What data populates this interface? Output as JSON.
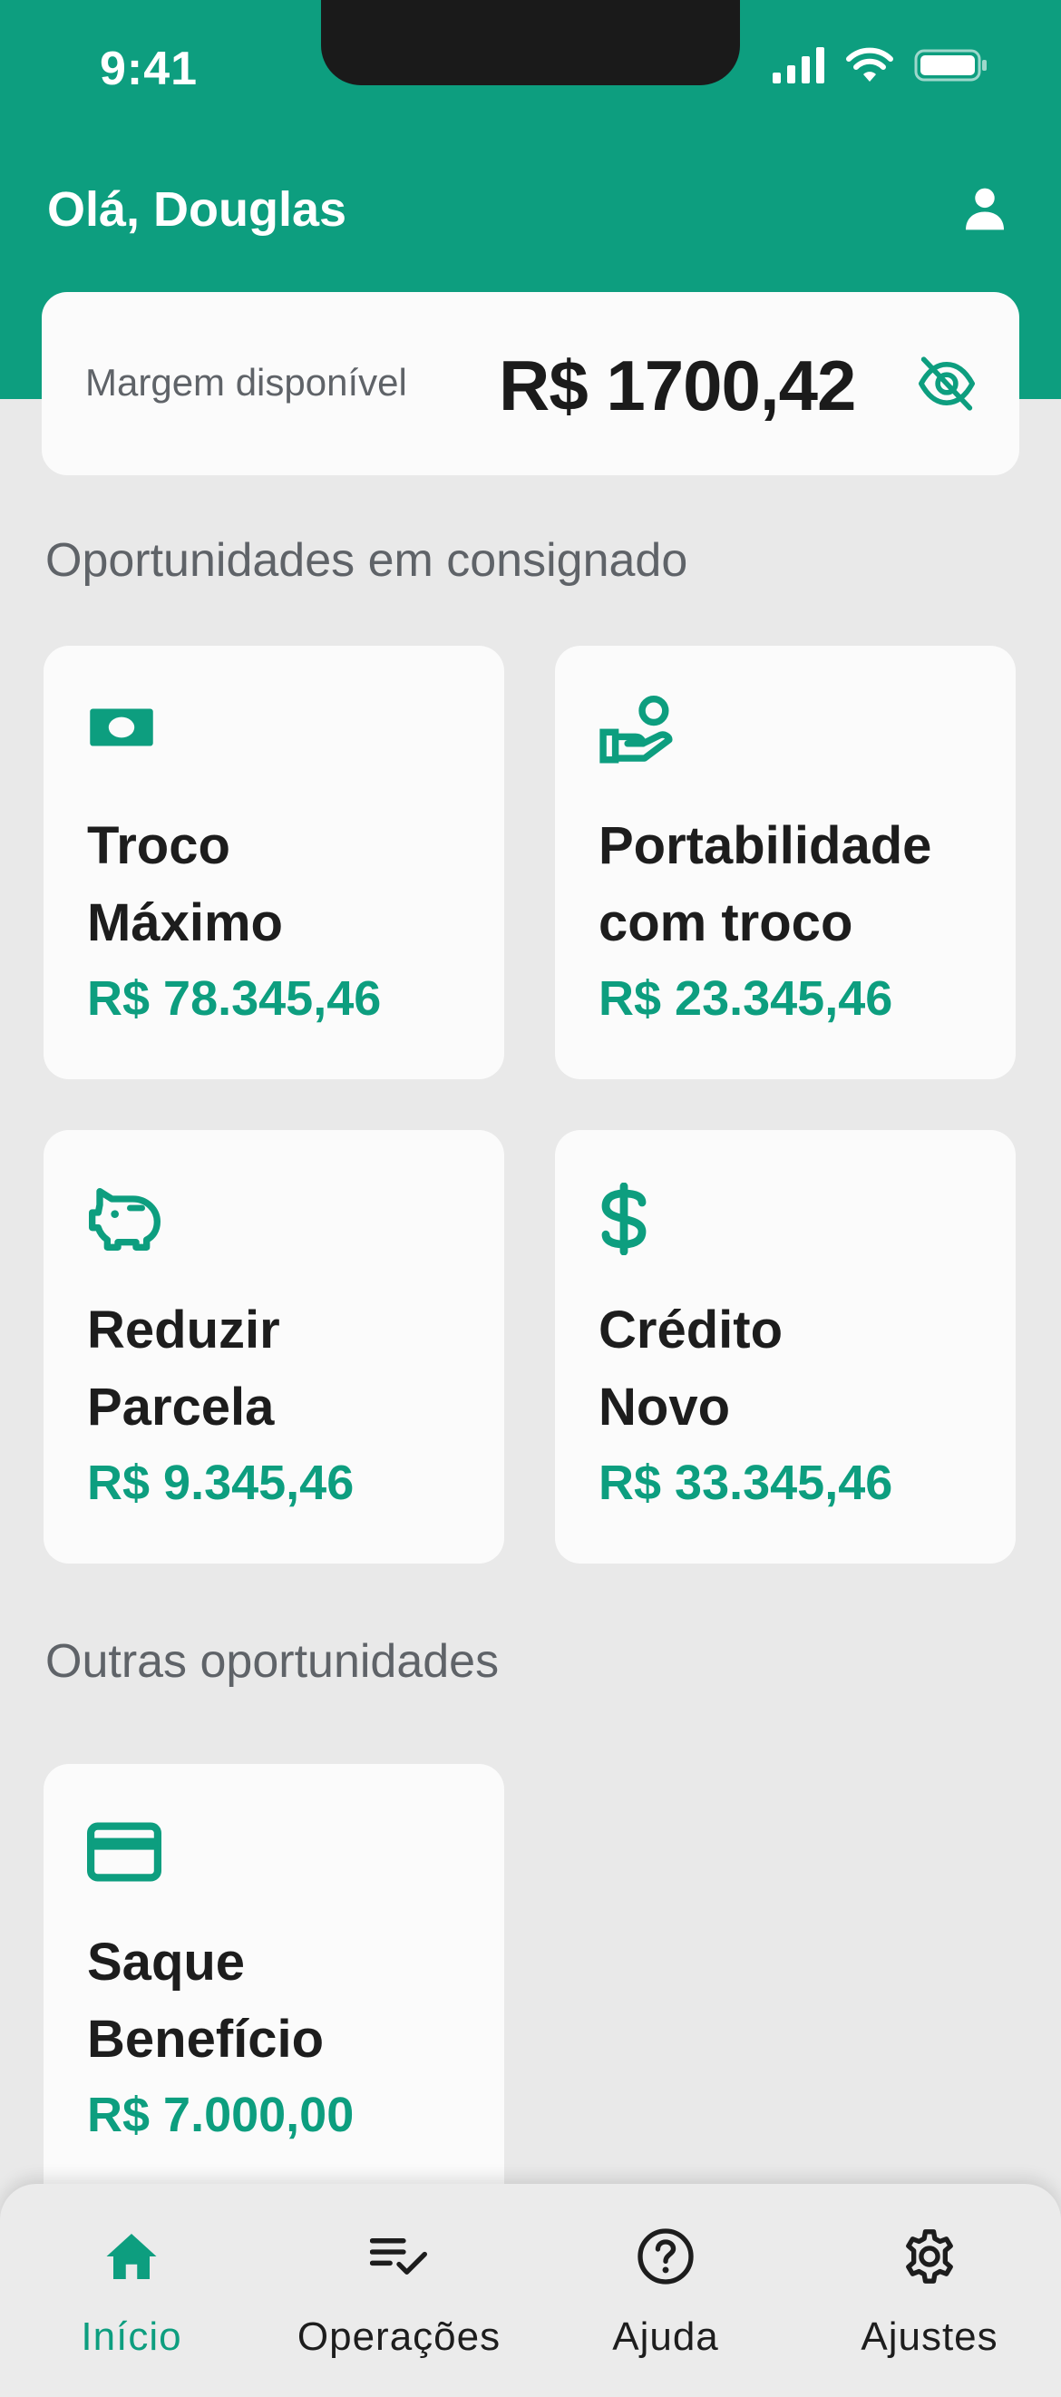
{
  "status_bar": {
    "time": "9:41"
  },
  "header": {
    "greeting": "Olá, Douglas"
  },
  "margin": {
    "label": "Margem disponível",
    "value": "R$ 1700,42"
  },
  "sections": {
    "consignado_title": "Oportunidades em consignado",
    "outras_title": "Outras oportunidades"
  },
  "cards": [
    {
      "icon": "cash-icon",
      "title_line1": "Troco",
      "title_line2": "Máximo",
      "value": "R$ 78.345,46"
    },
    {
      "icon": "hand-coin-icon",
      "title_line1": "Portabilidade",
      "title_line2": "com troco",
      "value": "R$ 23.345,46"
    },
    {
      "icon": "piggy-bank-icon",
      "title_line1": "Reduzir",
      "title_line2": "Parcela",
      "value": "R$ 9.345,46"
    },
    {
      "icon": "dollar-icon",
      "title_line1": "Crédito",
      "title_line2": "Novo",
      "value": "R$ 33.345,46"
    }
  ],
  "other_cards": [
    {
      "icon": "credit-card-icon",
      "title_line1": "Saque",
      "title_line2": "Benefício",
      "value": "R$ 7.000,00"
    }
  ],
  "nav": [
    {
      "icon": "home-icon",
      "label": "Início",
      "active": true
    },
    {
      "icon": "checklist-icon",
      "label": "Operações",
      "active": false
    },
    {
      "icon": "help-icon",
      "label": "Ajuda",
      "active": false
    },
    {
      "icon": "gear-icon",
      "label": "Ajustes",
      "active": false
    }
  ],
  "colors": {
    "brand": "#0d9e7f",
    "background": "#e9e9e9",
    "card": "#fbfbfb",
    "text": "#1d1d1d",
    "muted": "#5f6368"
  }
}
